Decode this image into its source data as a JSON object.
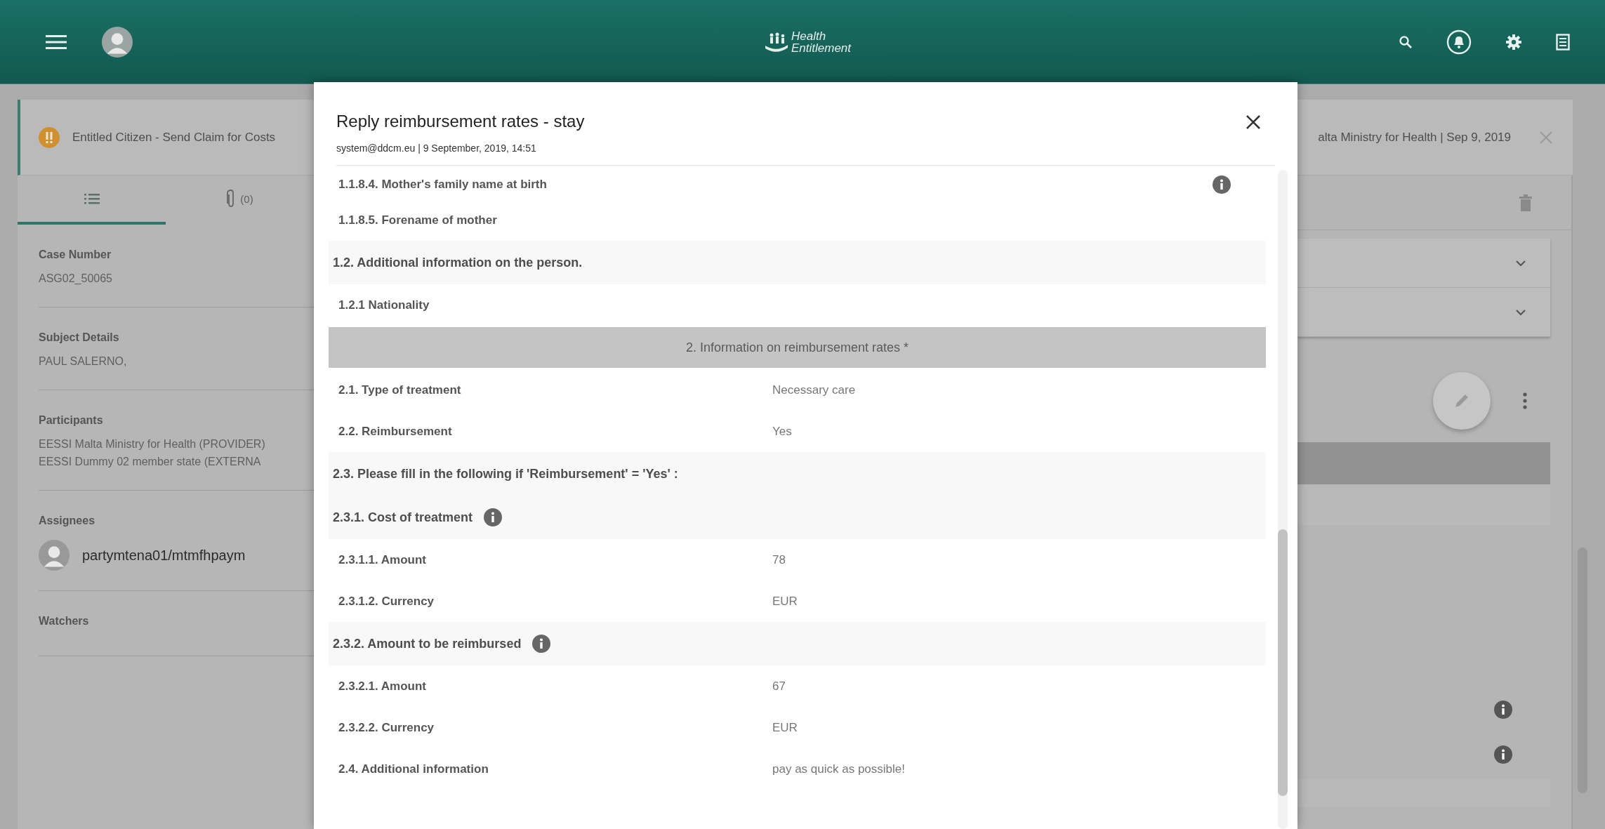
{
  "app_bar": {
    "logo": {
      "line_1": "Health",
      "line_2": "Entitlement"
    }
  },
  "banner": {
    "title": "Entitled Citizen - Send Claim for Costs",
    "meta": "alta Ministry for Health | Sep 9, 2019"
  },
  "side_tabs": [
    {
      "kind": "list",
      "selected": true
    },
    {
      "kind": "attachments",
      "count": "(0)",
      "selected": false
    }
  ],
  "details": [
    {
      "label": "Case Number",
      "lines": [
        "ASG02_50065"
      ]
    },
    {
      "label": "Subject Details",
      "lines": [
        "PAUL SALERNO,"
      ]
    },
    {
      "label": "Participants",
      "lines": [
        "EESSI Malta Ministry for Health (PROVIDER)",
        "EESSI Dummy 02 member state (EXTERNA"
      ]
    }
  ],
  "assignees": {
    "label": "Assignees",
    "users": [
      "partymtena01/mtmfhpaym"
    ]
  },
  "watchers": {
    "label": "Watchers"
  },
  "modal": {
    "title": "Reply reimbursement rates - stay",
    "subtitle": "system@ddcm.eu | 9 September, 2019, 14:51",
    "rows": [
      {
        "kind": "field",
        "label": "1.1.8.4. Mother's family name at birth",
        "info": true
      },
      {
        "kind": "field",
        "label": "1.1.8.5. Forename of mother",
        "info": false
      },
      {
        "kind": "subsection",
        "label": "1.2. Additional information on the person.",
        "info": false
      },
      {
        "kind": "field",
        "label": "1.2.1 Nationality",
        "info": false
      },
      {
        "kind": "section",
        "label": "2. Information on reimbursement rates *"
      },
      {
        "kind": "field",
        "label": "2.1. Type of treatment",
        "value": "Necessary care",
        "info": false
      },
      {
        "kind": "field",
        "label": "2.2. Reimbursement",
        "value": "Yes",
        "info": false
      },
      {
        "kind": "subsection",
        "label": "2.3. Please fill in the following if 'Reimbursement' = 'Yes' :",
        "info": false
      },
      {
        "kind": "subsection",
        "label": "2.3.1. Cost of treatment",
        "info": true
      },
      {
        "kind": "field",
        "label": "2.3.1.1. Amount",
        "value": "78",
        "info": false
      },
      {
        "kind": "field",
        "label": "2.3.1.2. Currency",
        "value": "EUR",
        "info": false
      },
      {
        "kind": "subsection",
        "label": "2.3.2. Amount to be reimbursed",
        "info": true
      },
      {
        "kind": "field",
        "label": "2.3.2.1. Amount",
        "value": "67",
        "info": false
      },
      {
        "kind": "field",
        "label": "2.3.2.2. Currency",
        "value": "EUR",
        "info": false
      },
      {
        "kind": "field",
        "label": "2.4. Additional information",
        "value": "pay as quick as possible!",
        "info": false
      }
    ]
  }
}
